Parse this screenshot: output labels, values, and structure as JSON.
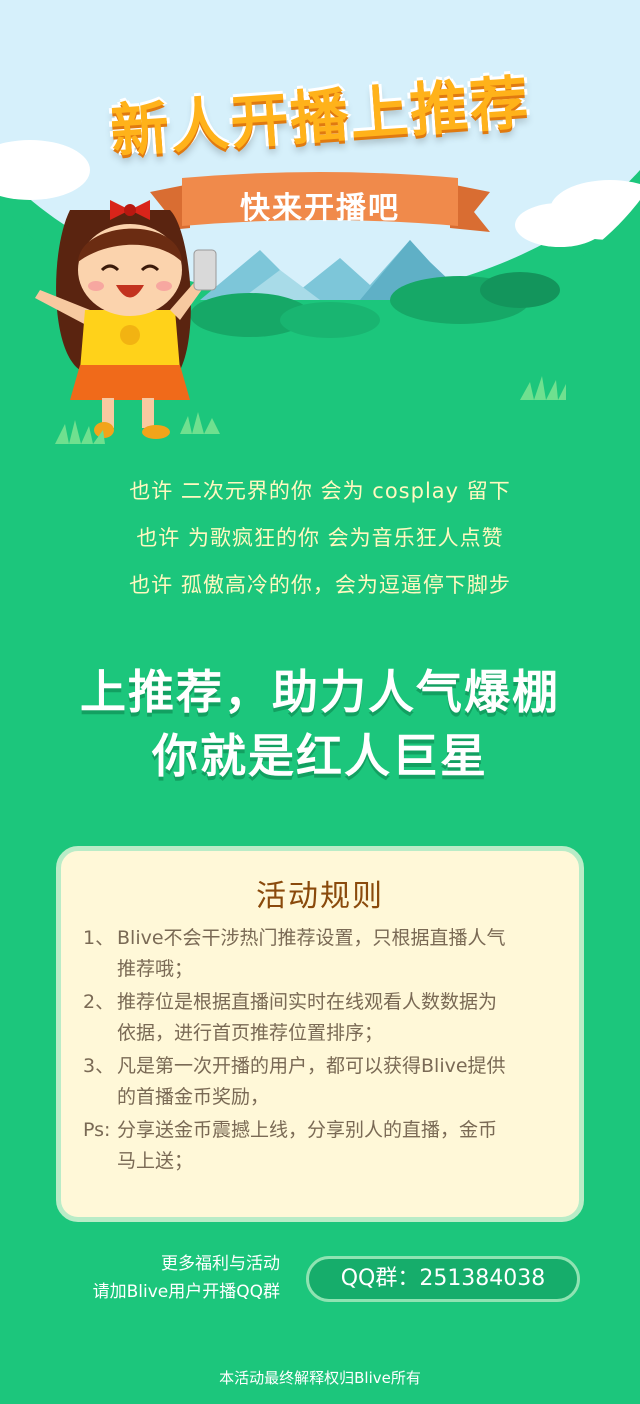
{
  "header": {
    "title": "新人开播上推荐",
    "ribbon": "快来开播吧"
  },
  "slogans": [
    "也许  二次元界的你  会为 cosplay 留下",
    "也许  为歌疯狂的你  会为音乐狂人点赞",
    "也许  孤傲高冷的你，会为逗逼停下脚步"
  ],
  "headline": {
    "line1": "上推荐，助力人气爆棚",
    "line2": "你就是红人巨星"
  },
  "rules": {
    "title": "活动规则",
    "items": [
      {
        "num": "1、",
        "line1": "Blive不会干涉热门推荐设置，只根据直播人气",
        "line2": "推荐哦；"
      },
      {
        "num": "2、",
        "line1": "推荐位是根据直播间实时在线观看人数数据为",
        "line2": "依据，进行首页推荐位置排序；"
      },
      {
        "num": "3、",
        "line1": "凡是第一次开播的用户，都可以获得Blive提供",
        "line2": "的首播金币奖励，"
      },
      {
        "num": "Ps:",
        "line1": "分享送金币震撼上线，分享别人的直播，金币",
        "line2": "马上送；"
      }
    ]
  },
  "contact": {
    "line1": "更多福利与活动",
    "line2": "请加Blive用户开播QQ群",
    "qq": "QQ群：251384038"
  },
  "footer": "本活动最终解释权归Blive所有",
  "colors": {
    "background": "#1cc67c",
    "title": "#ffb21a",
    "ribbon": "#f08a4b",
    "slogan": "#fff9c0",
    "card": "#fff8d8",
    "rules_title": "#8a4a0c"
  }
}
